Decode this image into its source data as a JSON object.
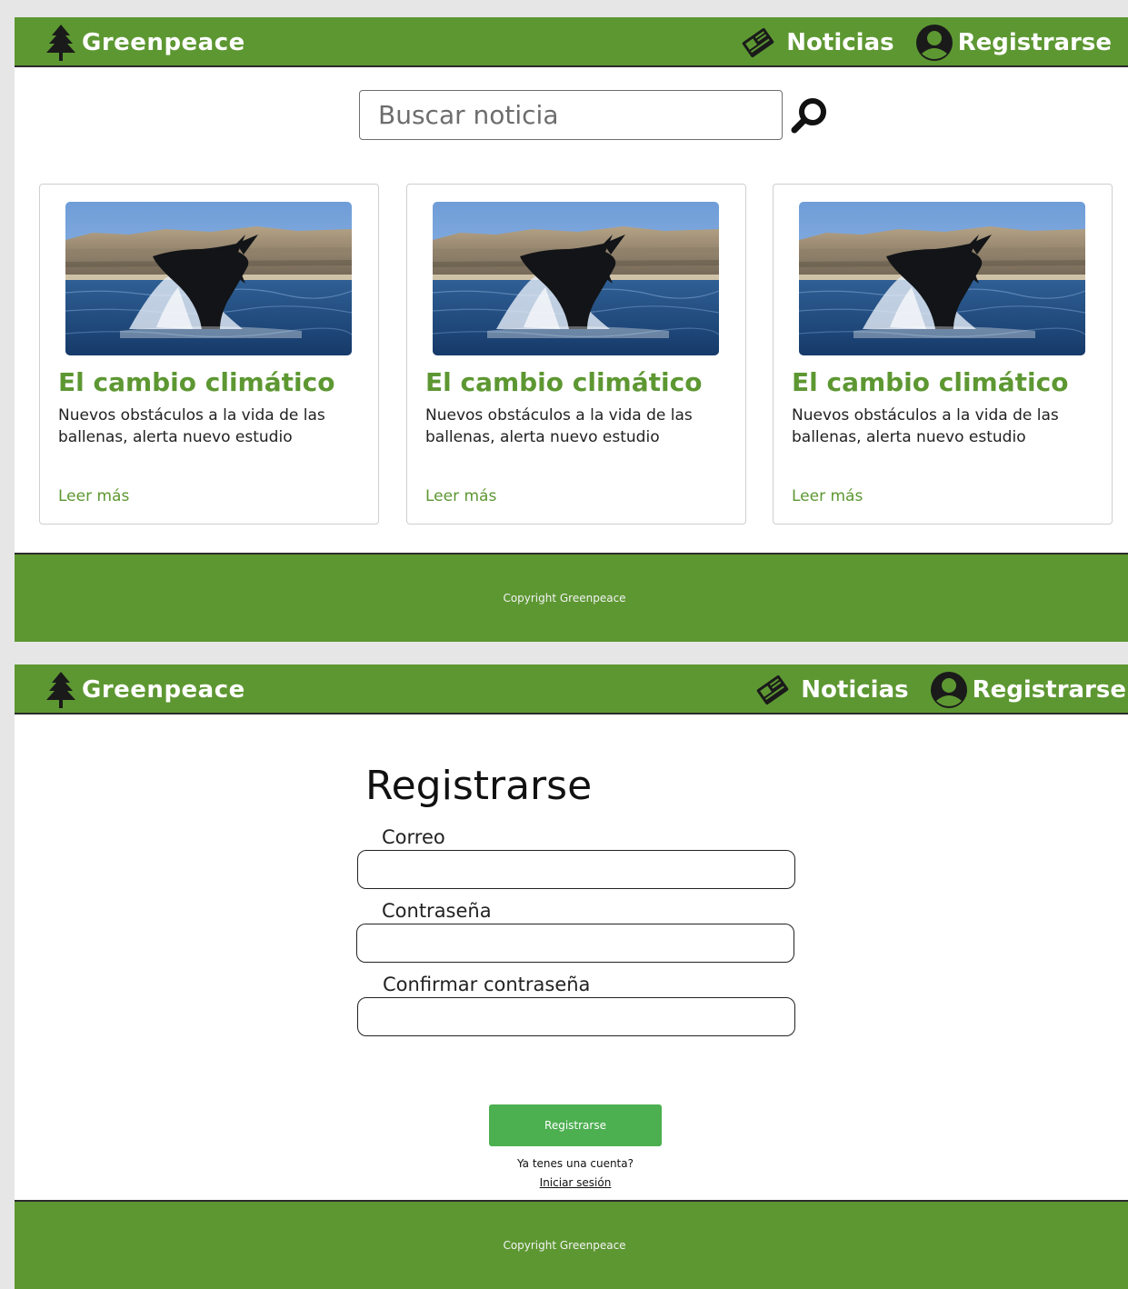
{
  "brand": {
    "name": "Greenpeace",
    "icon": "tree-icon"
  },
  "nav": {
    "news_label": "Noticias",
    "news_icon": "newspaper-icon",
    "register_label": "Registrarse",
    "register_icon": "user-avatar-icon"
  },
  "search": {
    "placeholder": "Buscar noticia",
    "value": "",
    "icon": "search-icon"
  },
  "cards": [
    {
      "title": "El cambio climático",
      "description": "Nuevos obstáculos a la vida de las ballenas, alerta nuevo estudio",
      "link": "Leer más",
      "image": "whale-breaching-photo"
    },
    {
      "title": "El cambio climático",
      "description": "Nuevos obstáculos a la vida de las ballenas, alerta nuevo estudio",
      "link": "Leer más",
      "image": "whale-breaching-photo"
    },
    {
      "title": "El cambio climático",
      "description": "Nuevos obstáculos a la vida de las ballenas, alerta nuevo estudio",
      "link": "Leer más",
      "image": "whale-breaching-photo"
    }
  ],
  "footer": {
    "text": "Copyright Greenpeace"
  },
  "register": {
    "title": "Registrarse",
    "email_label": "Correo",
    "email_value": "",
    "password_label": "Contraseña",
    "password_value": "",
    "confirm_label": "Confirmar contraseña",
    "confirm_value": "",
    "submit_label": "Registrarse",
    "have_account": "Ya tenes una cuenta?",
    "login_link": "Iniciar sesión"
  },
  "colors": {
    "brand_green": "#5d9732",
    "button_green": "#4caf50",
    "page_background": "#e6e6e6"
  }
}
